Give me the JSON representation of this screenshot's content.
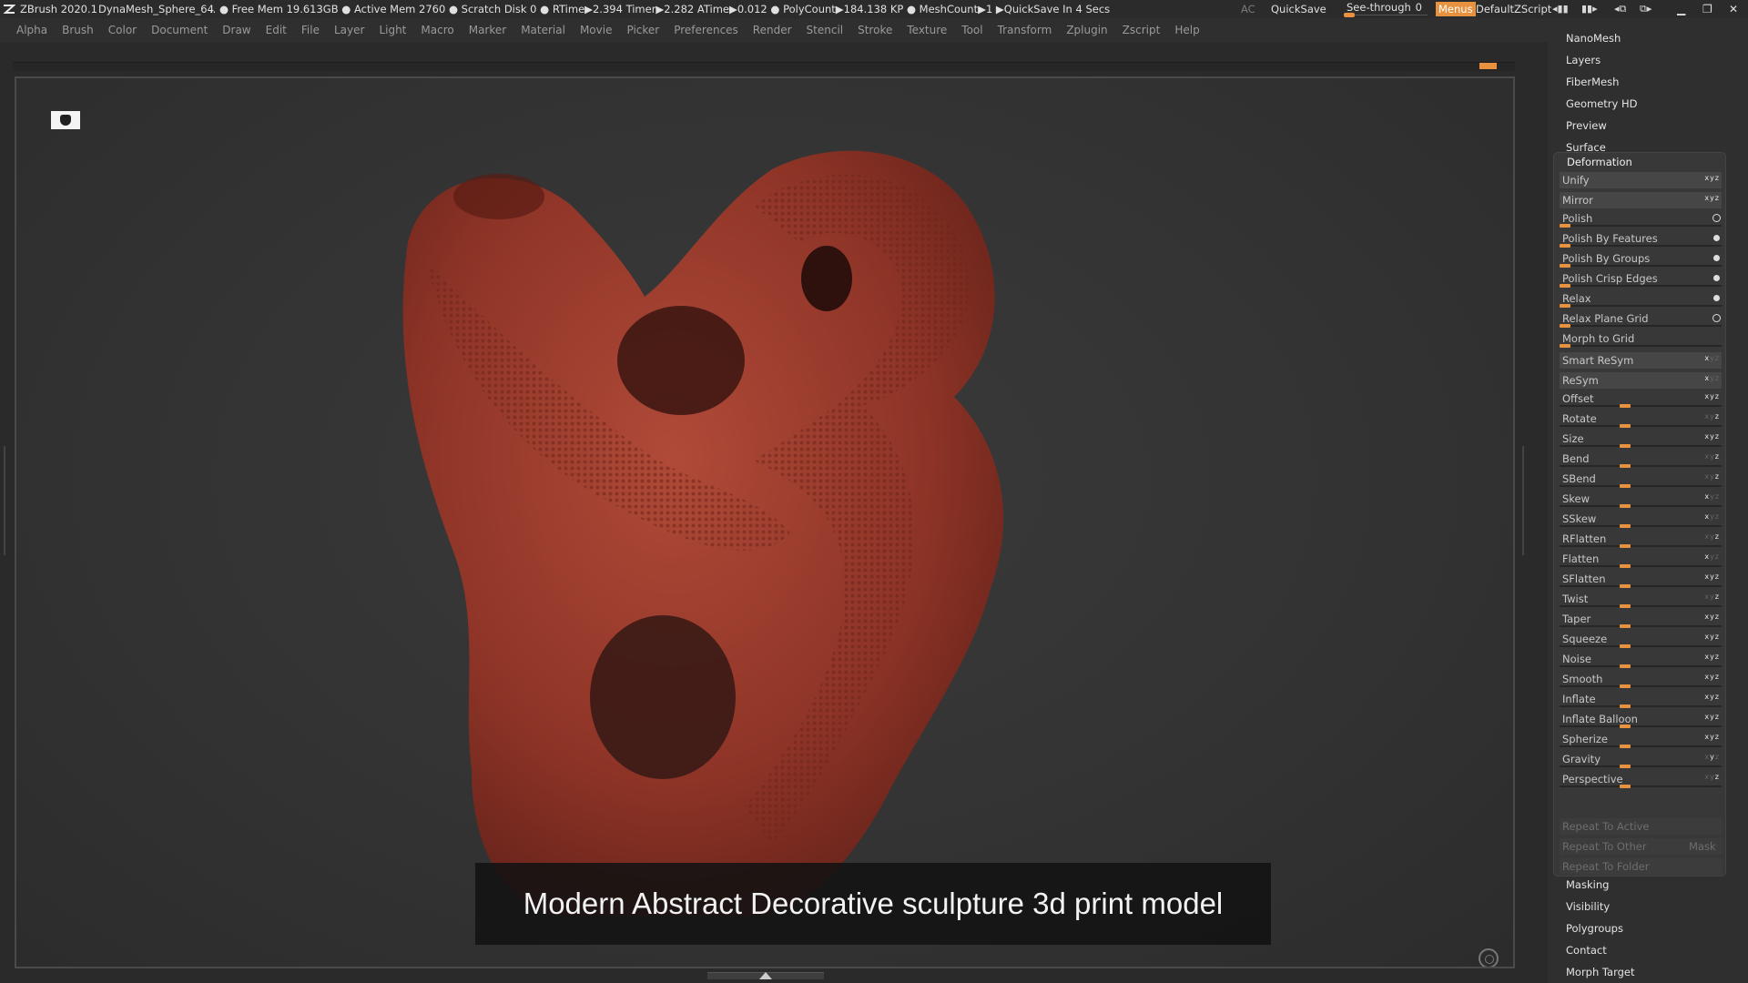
{
  "titlebar": {
    "app_title": "ZBrush 2020.1",
    "doc_name": "DynaMesh_Sphere_64",
    "stats": ".. ● Free Mem 19.613GB ● Active Mem 2760 ● Scratch Disk 0 ●  RTime▶2.394 Timer▶2.282 ATime▶0.012 ● PolyCount▶184.138 KP  ● MeshCount▶1  ▶QuickSave In 4 Secs",
    "ac": "AC",
    "quicksave": "QuickSave",
    "see_through_label": "See-through",
    "see_through_value": "0",
    "see_through_level": 0,
    "menus_label": "Menus",
    "menus_color": "#e8913f",
    "default_zscript": "DefaultZScript"
  },
  "menubar": [
    "Alpha",
    "Brush",
    "Color",
    "Document",
    "Draw",
    "Edit",
    "File",
    "Layer",
    "Light",
    "Macro",
    "Marker",
    "Material",
    "Movie",
    "Picker",
    "Preferences",
    "Render",
    "Stencil",
    "Stroke",
    "Texture",
    "Tool",
    "Transform",
    "Zplugin",
    "Zscript",
    "Help"
  ],
  "palette": {
    "top_headers": [
      "NanoMesh",
      "Layers",
      "FiberMesh",
      "Geometry HD",
      "Preview",
      "Surface"
    ],
    "deformation": {
      "title": "Deformation",
      "rows": [
        {
          "label": "Unify",
          "kind": "button"
        },
        {
          "label": "Mirror",
          "kind": "button"
        },
        {
          "label": "Polish",
          "kind": "slider-ring",
          "level": 0
        },
        {
          "label": "Polish By Features",
          "kind": "slider-dot",
          "level": 0
        },
        {
          "label": "Polish By Groups",
          "kind": "slider-dot",
          "level": 0
        },
        {
          "label": "Polish Crisp Edges",
          "kind": "slider-dot",
          "level": 0
        },
        {
          "label": "Relax",
          "kind": "slider-dot",
          "level": 0
        },
        {
          "label": "Relax Plane Grid",
          "kind": "slider-ring",
          "level": 0
        },
        {
          "label": "Morph to Grid",
          "kind": "slider",
          "level": 0
        },
        {
          "label": "Smart ReSym",
          "kind": "button"
        },
        {
          "label": "ReSym",
          "kind": "button"
        },
        {
          "label": "Offset",
          "kind": "slider-mid",
          "level": 0
        },
        {
          "label": "Rotate",
          "kind": "slider-mid",
          "level": 0
        },
        {
          "label": "Size",
          "kind": "slider-mid",
          "level": 0
        },
        {
          "label": "Bend",
          "kind": "slider-mid",
          "level": 0
        },
        {
          "label": "SBend",
          "kind": "slider-mid",
          "level": 0
        },
        {
          "label": "Skew",
          "kind": "slider-mid",
          "level": 0
        },
        {
          "label": "SSkew",
          "kind": "slider-mid",
          "level": 0
        },
        {
          "label": "RFlatten",
          "kind": "slider-mid",
          "level": 0
        },
        {
          "label": "Flatten",
          "kind": "slider-mid",
          "level": 0
        },
        {
          "label": "SFlatten",
          "kind": "slider-mid",
          "level": 0
        },
        {
          "label": "Twist",
          "kind": "slider-mid",
          "level": 0
        },
        {
          "label": "Taper",
          "kind": "slider-mid",
          "level": 0
        },
        {
          "label": "Squeeze",
          "kind": "slider-mid",
          "level": 0
        },
        {
          "label": "Noise",
          "kind": "slider-mid",
          "level": 0
        },
        {
          "label": "Smooth",
          "kind": "slider-mid",
          "level": 0
        },
        {
          "label": "Inflate",
          "kind": "slider-mid",
          "level": 0
        },
        {
          "label": "Inflate Balloon",
          "kind": "slider-mid",
          "level": 0
        },
        {
          "label": "Spherize",
          "kind": "slider-mid",
          "level": 0
        },
        {
          "label": "Gravity",
          "kind": "slider-mid",
          "level": 0
        },
        {
          "label": "Perspective",
          "kind": "slider-mid",
          "level": 0
        }
      ],
      "repeat_to_active": "Repeat To Active",
      "repeat_to_other": "Repeat To Other",
      "mask": "Mask",
      "repeat_to_folder": "Repeat To Folder"
    },
    "bottom_headers": [
      "Masking",
      "Visibility",
      "Polygroups",
      "Contact",
      "Morph Target"
    ]
  },
  "viewport": {
    "caption": "Modern Abstract Decorative sculpture 3d print model",
    "sculpture_color": "#9b3a2c"
  },
  "accent_color": "#e8913f"
}
